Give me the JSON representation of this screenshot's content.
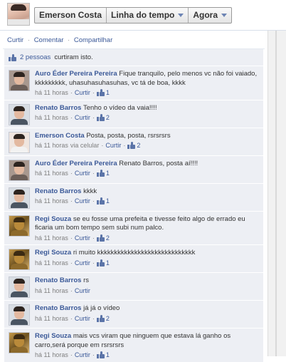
{
  "header": {
    "profile_name": "Emerson Costa",
    "timeline_label": "Linha do tempo",
    "time_label": "Agora"
  },
  "post_actions": {
    "like": "Curtir",
    "comment": "Comentar",
    "share": "Compartilhar",
    "separator": "·"
  },
  "likes": {
    "people": "2 pessoas",
    "suffix": "curtiram isto."
  },
  "comments": [
    {
      "author": "Auro Éder Pereira Pereira",
      "avatar": "auro",
      "text": "Fique tranquilo, pelo menos vc não foi vaiado, kkkkkkkkk, uhasuhasuhasuhas, vc tá de boa, kkkk",
      "time": "há 11 horas",
      "via": "",
      "like": "Curtir",
      "likes": "1"
    },
    {
      "author": "Renato Barros",
      "avatar": "renato",
      "text": "Tenho o vídeo da vaia!!!!",
      "time": "há 11 horas",
      "via": "",
      "like": "Curtir",
      "likes": "2"
    },
    {
      "author": "Emerson Costa",
      "avatar": "emerson",
      "text": "Posta, posta, posta, rsrsrsrs",
      "time": "há 11 horas",
      "via": "via celular",
      "like": "Curtir",
      "likes": "2"
    },
    {
      "author": "Auro Éder Pereira Pereira",
      "avatar": "auro",
      "text": "Renato Barros, posta aí!!!!",
      "time": "há 11 horas",
      "via": "",
      "like": "Curtir",
      "likes": "1"
    },
    {
      "author": "Renato Barros",
      "avatar": "renato",
      "text": "kkkk",
      "time": "há 11 horas",
      "via": "",
      "like": "Curtir",
      "likes": "1"
    },
    {
      "author": "Regi Souza",
      "avatar": "regi",
      "text": "se eu fosse uma prefeita e tivesse feito algo de errado eu ficaria um bom tempo sem subi num palco.",
      "time": "há 11 horas",
      "via": "",
      "like": "Curtir",
      "likes": "2"
    },
    {
      "author": "Regi Souza",
      "avatar": "regi",
      "text": "ri muito kkkkkkkkkkkkkkkkkkkkkkkkkkkkk",
      "time": "há 11 horas",
      "via": "",
      "like": "Curtir",
      "likes": "1"
    },
    {
      "author": "Renato Barros",
      "avatar": "renato",
      "text": "rs",
      "time": "há 11 horas",
      "via": "",
      "like": "Curtir",
      "likes": ""
    },
    {
      "author": "Renato Barros",
      "avatar": "renato",
      "text": "já já o vídeo",
      "time": "há 11 horas",
      "via": "",
      "like": "Curtir",
      "likes": "2"
    },
    {
      "author": "Regi Souza",
      "avatar": "regi",
      "text": "mais vcs viram que ninguem que estava lá ganho os carro,será porque em rsrsrsrs",
      "time": "há 11 horas",
      "via": "",
      "like": "Curtir",
      "likes": "1"
    }
  ],
  "meta_separator": "·",
  "icons": {
    "like_icon": "thumbs-up-icon",
    "caret": "chevron-down-icon"
  },
  "colors": {
    "link": "#3b5998",
    "comment_bg": "#edeff4",
    "meta": "#808080"
  }
}
